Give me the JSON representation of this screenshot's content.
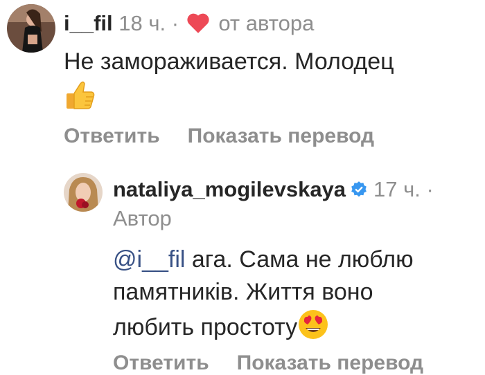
{
  "comment": {
    "username": "i__fil",
    "time": "18 ч.",
    "separator": "·",
    "liked_by_author": "от автора",
    "text": "Не замораживается. Молодец",
    "emoji": "thumbs-up",
    "actions": {
      "reply": "Ответить",
      "translate": "Показать перевод"
    }
  },
  "reply": {
    "username": "nataliya_mogilevskaya",
    "verified": true,
    "time": "17 ч.",
    "separator": "·",
    "author_label": "Автор",
    "mention": "@i__fil",
    "text_line1": " ага. Сама не люблю",
    "text_line2": "памятників. Життя воно",
    "text_line3": "любить простоту",
    "emoji": "heart-eyes",
    "actions": {
      "reply": "Ответить",
      "translate": "Показать перевод"
    }
  },
  "colors": {
    "heart": "#ed4956",
    "verified": "#3897f0",
    "mention": "#385185",
    "muted": "#8e8e8e",
    "text": "#262626"
  }
}
